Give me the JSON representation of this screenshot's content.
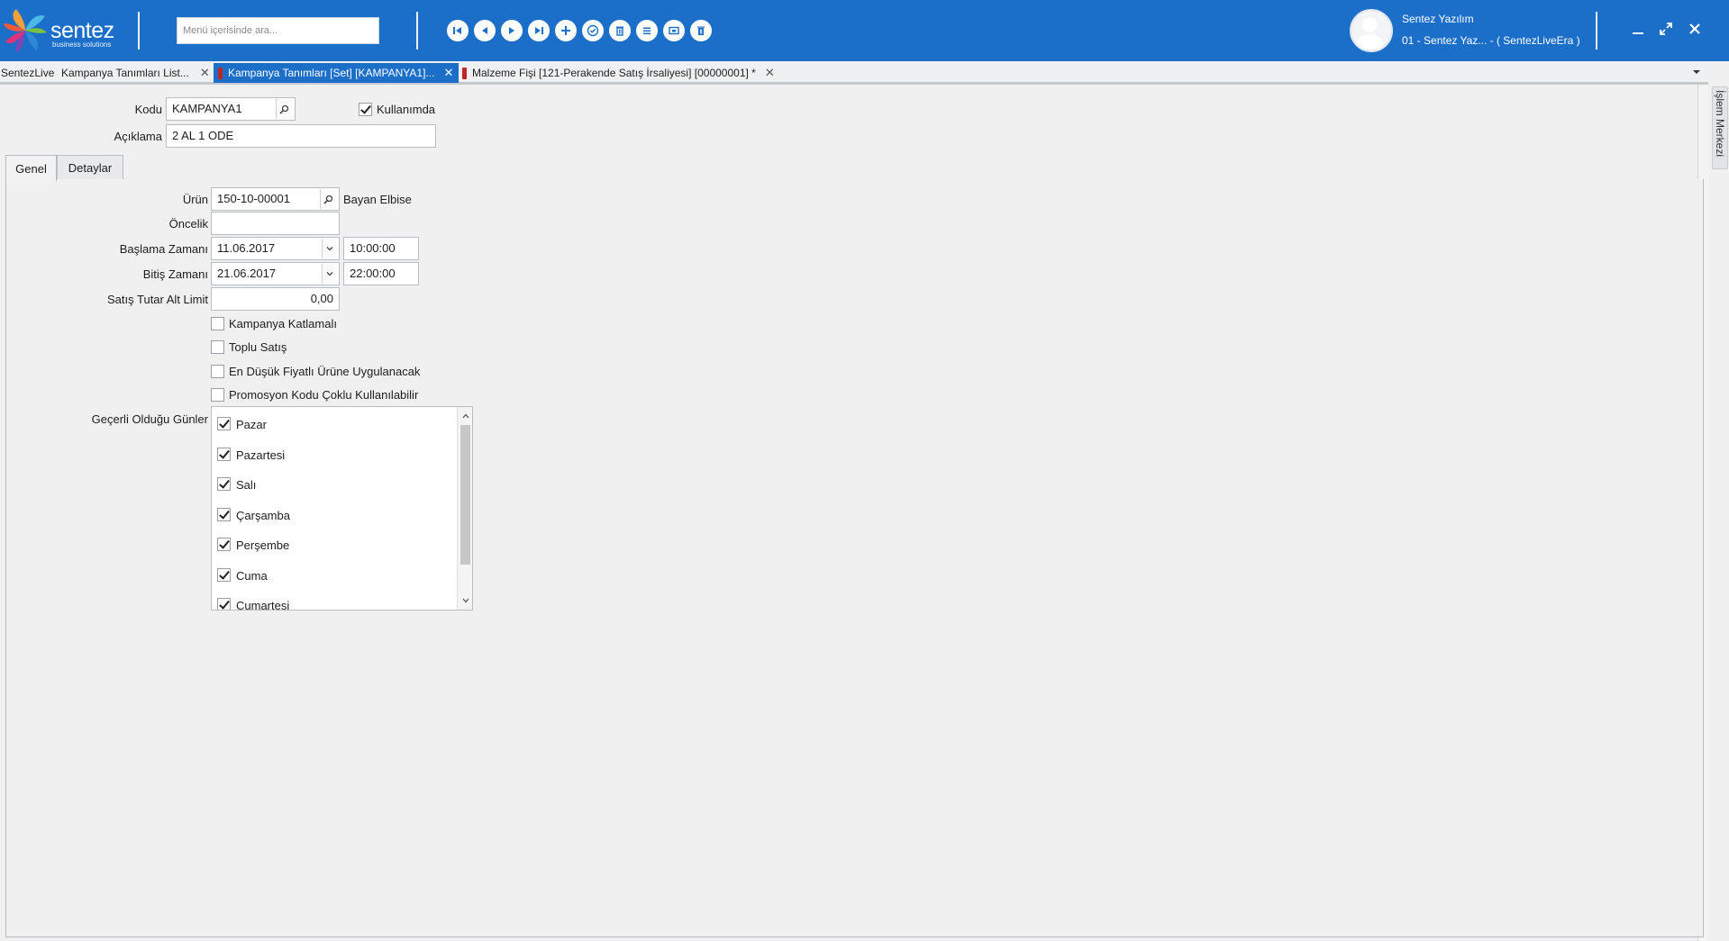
{
  "app": {
    "logo_text": "sentez",
    "logo_sub": "business solutions",
    "search_placeholder": "Menü içerisinde ara...",
    "user_name": "Sentez Yazılım",
    "user_company": "01 - Sentez Yaz... - ( SentezLiveEra )"
  },
  "toolbar": [
    {
      "icon": "first-record-icon"
    },
    {
      "icon": "previous-record-icon"
    },
    {
      "icon": "next-record-icon"
    },
    {
      "icon": "last-record-icon"
    },
    {
      "icon": "add-icon"
    },
    {
      "icon": "save-check-icon"
    },
    {
      "icon": "delete-icon"
    },
    {
      "icon": "list-icon"
    },
    {
      "icon": "window-icon"
    },
    {
      "icon": "trash-icon"
    }
  ],
  "doc_tabs": {
    "home": "SentezLive",
    "tab1": "Kampanya Tanımları List...",
    "tab2": "Kampanya Tanımları  [Set] [KAMPANYA1]...",
    "tab3": "Malzeme Fişi [121-Perakende Satış İrsaliyesi]  [00000001]  *"
  },
  "side_panel_label": "İşlem Merkezi",
  "form": {
    "kodu_label": "Kodu",
    "kodu_value": "KAMPANYA1",
    "kullanimda_label": "Kullanımda",
    "kullanimda_checked": true,
    "aciklama_label": "Açıklama",
    "aciklama_value": "2 AL 1 ODE"
  },
  "subtabs": {
    "genel": "Genel",
    "detaylar": "Detaylar"
  },
  "genel": {
    "urun_label": "Ürün",
    "urun_value": "150-10-00001",
    "urun_name": "Bayan Elbise",
    "oncelik_label": "Öncelik",
    "oncelik_value": "",
    "baslama_label": "Başlama Zamanı",
    "baslama_date": "11.06.2017",
    "baslama_time": "10:00:00",
    "bitis_label": "Bitiş Zamanı",
    "bitis_date": "21.06.2017",
    "bitis_time": "22:00:00",
    "satis_label": "Satış Tutar Alt Limit",
    "satis_value": "0,00",
    "katlamali_label": "Kampanya Katlamalı",
    "toplu_label": "Toplu Satış",
    "en_dusuk_label": "En Düşük Fiyatlı Ürüne Uygulanacak",
    "promosyon_label": "Promosyon Kodu Çoklu Kullanılabilir",
    "gunler_label": "Geçerli Olduğu Günler",
    "days": [
      "Pazar",
      "Pazartesi",
      "Salı",
      "Çarşamba",
      "Perşembe",
      "Cuma",
      "Cumartesi"
    ]
  },
  "colors": {
    "header_blue": "#1c6fc8",
    "tab_marker_red": "#c02525"
  }
}
